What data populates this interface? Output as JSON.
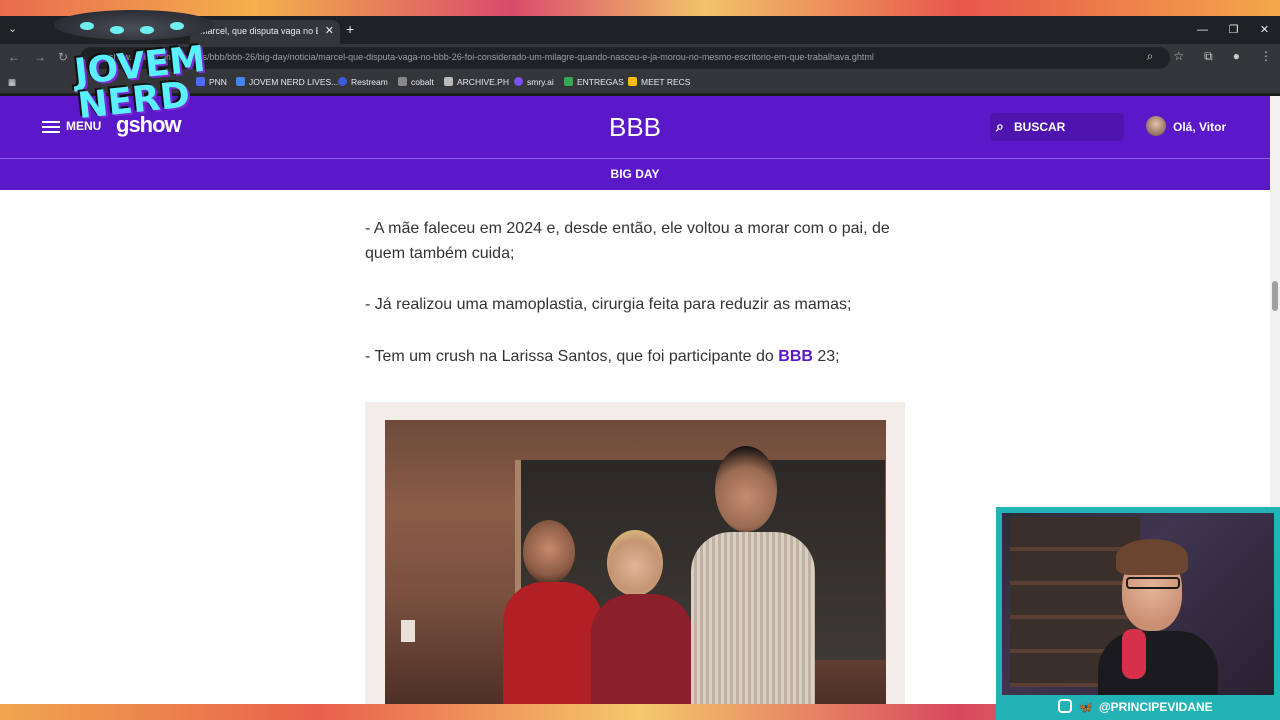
{
  "browser": {
    "tab_title": "Marcel, que disputa vaga no BBB",
    "url": "gshow.globo.com/realities/bbb/bbb-26/big-day/noticia/marcel-que-disputa-vaga-no-bbb-26-foi-considerado-um-milagre-quando-nasceu-e-ja-morou-no-mesmo-escritorio-em-que-trabalhava.ghtml",
    "bookmarks": [
      {
        "label": "PNN",
        "color": "#4a6cf7"
      },
      {
        "label": "JOVEM NERD LIVES...",
        "color": "#4285f4"
      },
      {
        "label": "Restream",
        "color": "#3b5bdb"
      },
      {
        "label": "cobalt",
        "color": "#888888"
      },
      {
        "label": "ARCHIVE.PH",
        "color": "#bbbbbb"
      },
      {
        "label": "smry.ai",
        "color": "#7950f2"
      },
      {
        "label": "ENTREGAS",
        "color": "#34a853"
      },
      {
        "label": "MEET RECS",
        "color": "#fbbc04"
      }
    ]
  },
  "site": {
    "menu_label": "MENU",
    "logo": "gshow",
    "section_title": "BBB",
    "search_label": "BUSCAR",
    "user_greeting": "Olá, Vitor",
    "subnav_label": "BIG DAY",
    "brand_color": "#5a18c8"
  },
  "article": {
    "p1": "- A mãe faleceu em 2024 e, desde então, ele voltou a morar com o pai, de quem também cuida;",
    "p2": "- Já realizou uma mamoplastia, cirurgia feita para reduzir as mamas;",
    "p3_before": "- Tem um crush na Larissa Santos, que foi participante do ",
    "p3_link": "BBB",
    "p3_after": " 23;"
  },
  "overlay": {
    "nerd_logo": "JOVEM NERD",
    "streamer_handle": "@PRINCIPEVIDANE"
  }
}
